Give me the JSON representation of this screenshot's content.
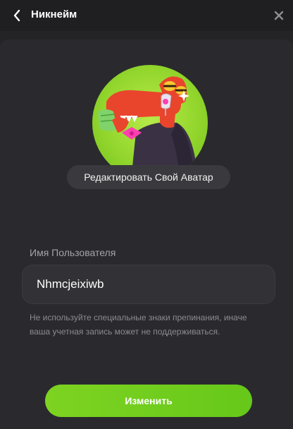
{
  "header": {
    "title": "Никнейм",
    "back_icon": "chevron-left-icon",
    "close_icon": "close-icon"
  },
  "avatar": {
    "edit_label": "Редактировать Свой Аватар"
  },
  "username": {
    "label": "Имя Пользователя",
    "value": "Nhmcjeixiwb",
    "hint": "Не используйте специальные знаки препинания, иначе ваша учетная запись может не поддерживаться."
  },
  "actions": {
    "submit_label": "Изменить"
  },
  "colors": {
    "accent": "#76d01e",
    "background": "#242427",
    "panel": "#2a2a2e"
  }
}
